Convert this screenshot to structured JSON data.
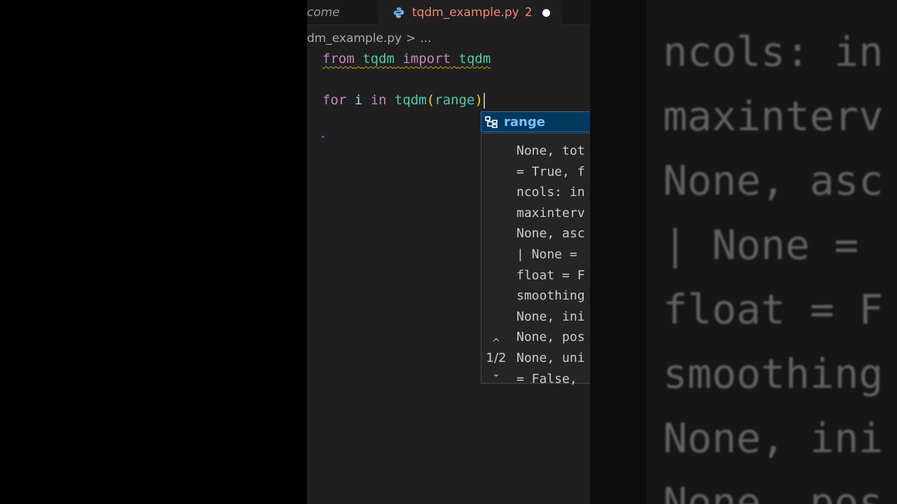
{
  "tabs": {
    "inactive_label": "come",
    "active_label": "tqdm_example.py",
    "active_problem_count": "2"
  },
  "breadcrumb": {
    "file": "dm_example.py",
    "separator": ">",
    "more": "..."
  },
  "code": {
    "line1": {
      "kw1": "from",
      "module": "tqdm",
      "kw2": "import",
      "name": "tqdm"
    },
    "line2": {
      "kw1": "for",
      "var": "i",
      "kw2": "in",
      "fn": "tqdm",
      "open": "(",
      "arg": "range",
      "close": ")"
    },
    "marker": "‸"
  },
  "suggestion": {
    "label": "range",
    "icon": "class-icon"
  },
  "signature_help": {
    "lines": [
      "None, tot",
      "= True, f",
      "ncols: in",
      "maxinterv",
      "None, asc",
      "| None = ",
      "float = F",
      "smoothing",
      "None, ini",
      "None, pos",
      "None, uni",
      "= False, "
    ],
    "page": "1/2",
    "up": "^",
    "down": "⌄"
  },
  "backdrop_zoom": {
    "lines": [
      "ncols: in",
      "maxinterv",
      "None, asc",
      "| None = ",
      "float = F",
      "smoothing",
      "None, ini",
      "None, pos"
    ]
  },
  "colors": {
    "editor_bg": "#1f1f1f",
    "tab_error": "#f48771",
    "keyword": "#c586c0",
    "function": "#4ec9b0",
    "suggest_bg": "#04395e"
  }
}
